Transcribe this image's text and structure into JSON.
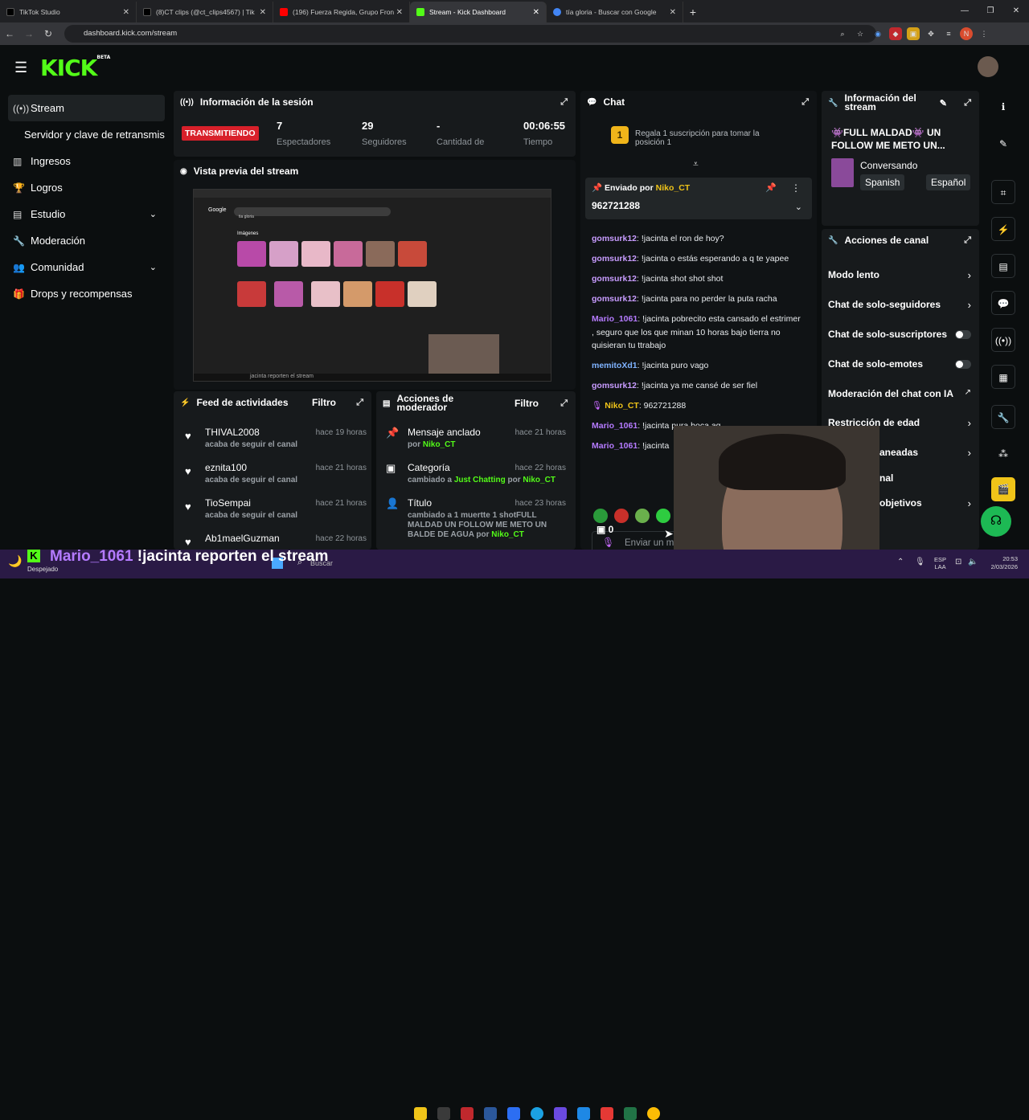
{
  "browser": {
    "tabs": [
      {
        "label": "TikTok Studio",
        "color": "#000000"
      },
      {
        "label": "(8)CT clips (@ct_clips4567) | Tik",
        "color": "#000000"
      },
      {
        "label": "(196) Fuerza Regida, Grupo Fron",
        "color": "#ff0000"
      },
      {
        "label": "Stream - Kick Dashboard",
        "color": "#53fc18"
      },
      {
        "label": "tía gloria - Buscar con Google",
        "color": "#4285f4"
      }
    ],
    "url": "dashboard.kick.com/stream"
  },
  "brand": {
    "logo": "KICK",
    "badge": "BETA",
    "accent": "#53fc18"
  },
  "sidebar": {
    "items": [
      {
        "label": "Stream",
        "icon": "broadcast-icon"
      },
      {
        "label": "Servidor y clave de retransmisión",
        "icon": ""
      },
      {
        "label": "Ingresos",
        "icon": "chart-icon"
      },
      {
        "label": "Logros",
        "icon": "trophy-icon"
      },
      {
        "label": "Estudio",
        "icon": "film-icon"
      },
      {
        "label": "Moderación",
        "icon": "wrench-icon"
      },
      {
        "label": "Comunidad",
        "icon": "people-icon"
      },
      {
        "label": "Drops y recompensas",
        "icon": "gift-icon"
      }
    ]
  },
  "session": {
    "title": "Información de la sesión",
    "status": "TRANSMITIENDO",
    "stats": [
      {
        "value": "7",
        "label": "Espectadores"
      },
      {
        "value": "29",
        "label": "Seguidores"
      },
      {
        "value": "-",
        "label": "Cantidad de"
      },
      {
        "value": "00:06:55",
        "label": "Tiempo"
      }
    ]
  },
  "preview": {
    "title": "Vista previa del stream",
    "google_logo": "Google",
    "search_value": "tia gloria",
    "images_heading": "Imágenes",
    "caption": "jacinta reporten el stream"
  },
  "feed": {
    "title": "Feed de actividades",
    "filter": "Filtro",
    "items": [
      {
        "name": "THIVAL2008",
        "time": "hace 19 horas",
        "desc": "acaba de seguir el canal"
      },
      {
        "name": "eznita100",
        "time": "hace 21 horas",
        "desc": "acaba de seguir el canal"
      },
      {
        "name": "TioSempai",
        "time": "hace 21 horas",
        "desc": "acaba de seguir el canal"
      },
      {
        "name": "Ab1maelGuzman",
        "time": "hace 22 horas",
        "desc": ""
      }
    ]
  },
  "modactions": {
    "title": "Acciones de moderador",
    "filter": "Filtro",
    "items": [
      {
        "name": "Mensaje anclado",
        "time": "hace 21 horas",
        "prefix": "por ",
        "who": "Niko_CT"
      },
      {
        "name": "Categoría",
        "time": "hace 22 horas",
        "prefix": "cambiado a ",
        "cat": "Just Chatting",
        "mid": " por ",
        "who": "Niko_CT"
      },
      {
        "name": "Título",
        "time": "hace 23 horas",
        "prefix": "cambiado a 1 muertte 1 shotFULL MALDAD UN FOLLOW ME METO UN BALDE DE AGUA",
        "mid": " por ",
        "who": "Niko_CT"
      }
    ]
  },
  "chat": {
    "title": "Chat",
    "gift_text": "Regala 1 suscripción para tomar la posición 1",
    "gift_rank": "1",
    "pinned_label": "Enviado por",
    "pinned_user": "Niko_CT",
    "pinned_message": "962721288",
    "messages": [
      {
        "user": "gomsurk12",
        "color": "#c89cff",
        "text": ": !jacinta el ron de hoy?"
      },
      {
        "user": "gomsurk12",
        "color": "#c89cff",
        "text": ": !jacinta o estás esperando a q te yapee"
      },
      {
        "user": "gomsurk12",
        "color": "#c89cff",
        "text": ": !jacinta shot shot shot"
      },
      {
        "user": "gomsurk12",
        "color": "#c89cff",
        "text": ": !jacinta para no perder la puta racha"
      },
      {
        "user": "Mario_1061",
        "color": "#b57bff",
        "text": ": !jacinta pobrecito esta cansado el estrimer , seguro que los que minan 10 horas bajo tierra no quisieran tu ttrabajo"
      },
      {
        "user": "memitoXd1",
        "color": "#7fb3ff",
        "text": ": !jacinta puro vago"
      },
      {
        "user": "gomsurk12",
        "color": "#c89cff",
        "text": ": !jacinta ya me cansé de ser fiel"
      },
      {
        "user": "Niko_CT",
        "color": "#f0c419",
        "text": ": 962721288"
      },
      {
        "user": "Mario_1061",
        "color": "#b57bff",
        "text": ": !jacinta pura boca ag"
      },
      {
        "user": "Mario_1061",
        "color": "#b57bff",
        "text": ": !jacinta"
      }
    ],
    "input_placeholder": "Enviar un m",
    "points": "0"
  },
  "streaminfo": {
    "title": "Información del stream",
    "stream_title": "👾FULL MALDAD👾 UN FOLLOW ME METO UN...",
    "category": "Conversando",
    "tags": [
      "Spanish",
      "Español"
    ]
  },
  "channelactions": {
    "title": "Acciones de canal",
    "items": [
      {
        "label": "Modo lento",
        "kind": "arrow"
      },
      {
        "label": "Chat de solo-seguidores",
        "kind": "arrow"
      },
      {
        "label": "Chat de solo-suscriptores",
        "kind": "toggle"
      },
      {
        "label": "Chat de solo-emotes",
        "kind": "toggle"
      },
      {
        "label": "Moderación del chat con IA",
        "kind": "external"
      },
      {
        "label": "Restricción de edad",
        "kind": "arrow"
      },
      {
        "label": "aneadas",
        "kind": "arrow"
      },
      {
        "label": "nal",
        "kind": ""
      },
      {
        "label": "objetivos",
        "kind": "arrow"
      }
    ]
  },
  "taskbar": {
    "weather": "Despejado",
    "chat_user": "Mario_1061",
    "chat_text": " !jacinta reporten el stream",
    "search": "Buscar",
    "lang": "ESP",
    "lang2": "LAA",
    "time": "20:53",
    "date": "2/03/2026"
  }
}
